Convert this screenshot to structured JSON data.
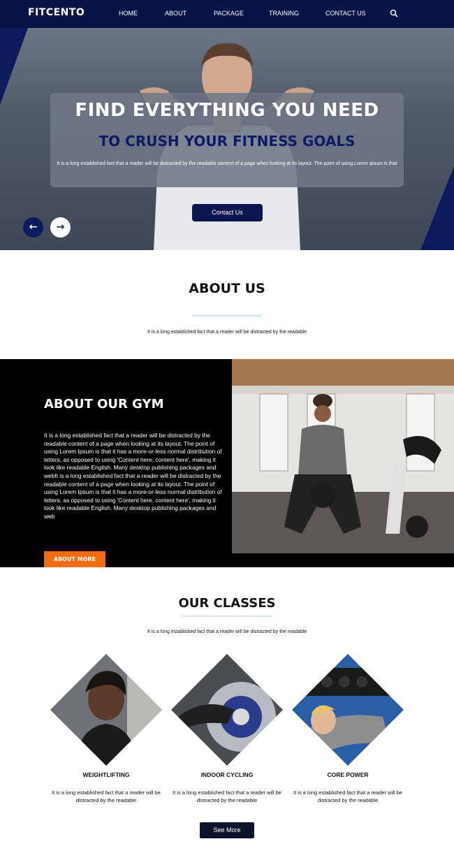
{
  "brand": {
    "logo": "FITCENTO"
  },
  "nav": {
    "items": [
      {
        "label": "HOME"
      },
      {
        "label": "ABOUT"
      },
      {
        "label": "PACKAGE"
      },
      {
        "label": "TRAINING"
      },
      {
        "label": "CONTACT US"
      }
    ],
    "search_icon": "search-icon"
  },
  "hero": {
    "heading": "FIND EVERYTHING YOU NEED",
    "subheading": "TO CRUSH YOUR FITNESS GOALS",
    "text": "It is a long established fact that a reader will be distracted by the readable content of a page when looking at its layout. The point of using Lorem Ipsum is that",
    "button": "Contact Us",
    "prev_icon": "arrow-left-icon",
    "next_icon": "arrow-right-icon"
  },
  "about": {
    "title": "ABOUT US",
    "text": "It is a long established fact that a reader will be distracted by the readable"
  },
  "gym": {
    "title": "ABOUT OUR GYM",
    "text": "It is a long established fact that a reader will be distracted by the readable content of a page when looking at its layout. The point of using Lorem Ipsum is that it has a more-or-less normal distribution of letters, as opposed to using 'Content here, content here', making it look like readable English. Many desktop publishing packages and webIt is a long established fact that a reader will be distracted by the readable content of a page when looking at its layout. The point of using Lorem Ipsum is that it has a more-or-less normal distribution of letters, as opposed to using 'Content here, content here', making it look like readable English. Many desktop publishing packages and web",
    "button": "ABOUT MORE"
  },
  "classes": {
    "title": "OUR CLASSES",
    "text": "It is a long established fact that a reader will be distracted by the readable",
    "items": [
      {
        "name": "WEIGHTLIFTING",
        "text": "It is a long established fact that a reader will be distracted by the readable"
      },
      {
        "name": "INDOOR CYCLING",
        "text": "It is a long established fact that a reader will be distracted by the readable"
      },
      {
        "name": "CORE POWER",
        "text": "It is a long established fact that a reader will be distracted by the readable"
      }
    ],
    "button": "See More"
  },
  "colors": {
    "navy": "#091446",
    "accent_orange": "#f26c12",
    "dark_button": "#0b1428"
  }
}
